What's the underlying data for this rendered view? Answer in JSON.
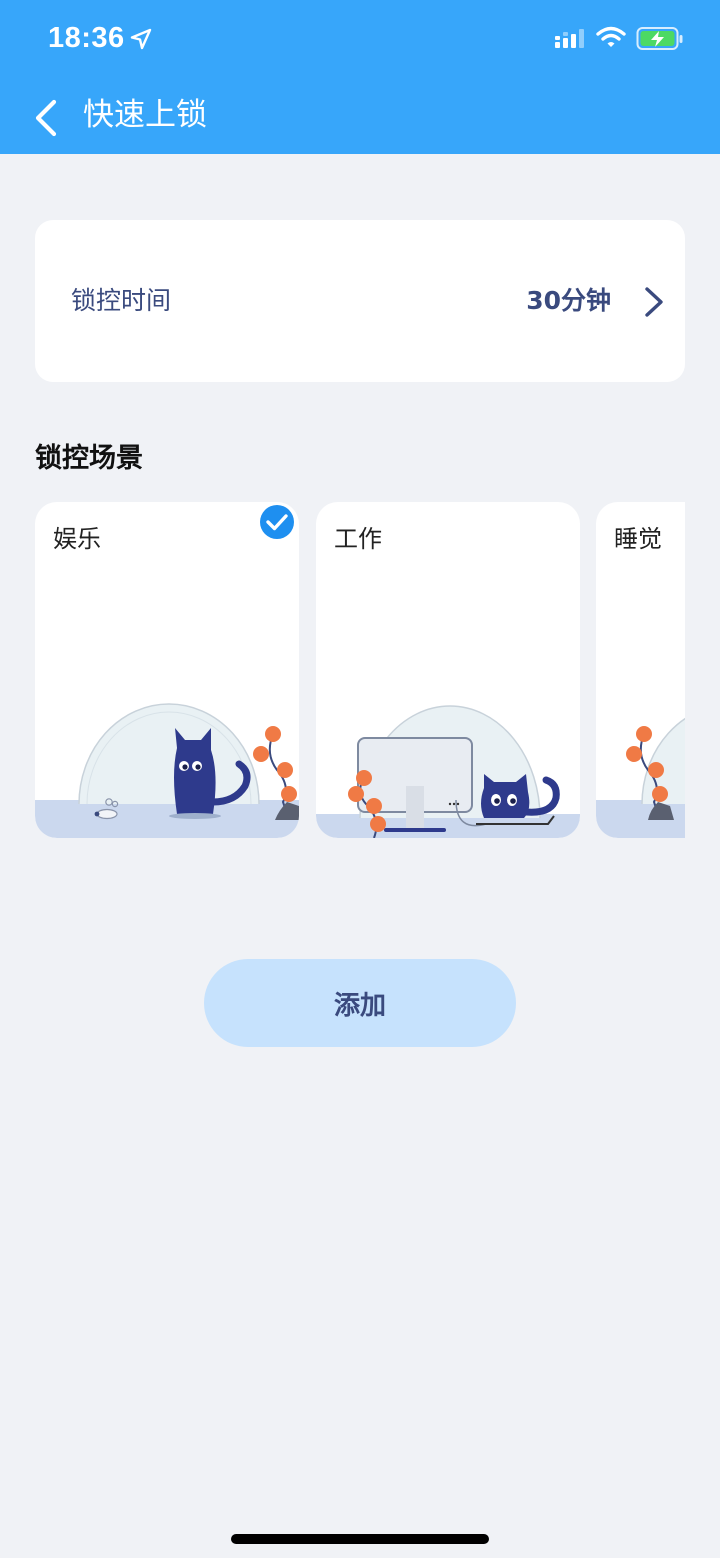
{
  "status_bar": {
    "time": "18:36",
    "icons": [
      "location-arrow-icon",
      "cellular-signal-icon",
      "wifi-icon",
      "battery-charging-icon"
    ]
  },
  "nav": {
    "title": "快速上锁",
    "back_icon": "chevron-left-icon"
  },
  "lock_time": {
    "label": "锁控时间",
    "value": "30分钟",
    "icon": "chevron-right-icon"
  },
  "scenes": {
    "title": "锁控场景",
    "items": [
      {
        "label": "娱乐",
        "selected": true
      },
      {
        "label": "工作",
        "selected": false
      },
      {
        "label": "睡觉",
        "selected": false
      }
    ]
  },
  "actions": {
    "add_label": "添加"
  },
  "colors": {
    "header": "#37a6fa",
    "background": "#f0f2f6",
    "accent_text": "#3a4a7e",
    "add_button": "#c6e2fd",
    "check": "#1e8ff0",
    "cat": "#2e3a8c",
    "berry": "#f07a45"
  }
}
